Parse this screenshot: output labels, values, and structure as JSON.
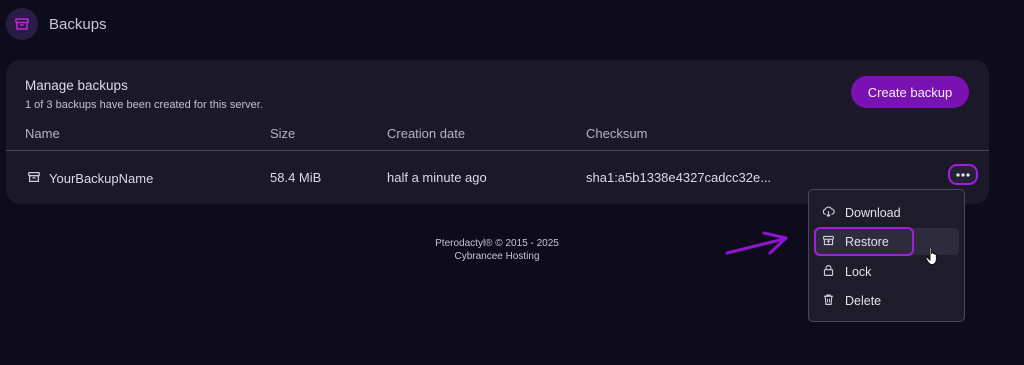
{
  "header": {
    "title": "Backups",
    "icon": "archive-icon"
  },
  "panel": {
    "title": "Manage backups",
    "subtitle": "1 of 3 backups have been created for this server.",
    "create_button": "Create backup"
  },
  "table": {
    "columns": [
      "Name",
      "Size",
      "Creation date",
      "Checksum"
    ],
    "rows": [
      {
        "name": "YourBackupName",
        "size": "58.4 MiB",
        "created": "half a minute ago",
        "checksum": "sha1:a5b1338e4327cadcc32e..."
      }
    ]
  },
  "menu": {
    "items": [
      {
        "label": "Download",
        "icon": "cloud-download-icon"
      },
      {
        "label": "Restore",
        "icon": "archive-restore-icon"
      },
      {
        "label": "Lock",
        "icon": "lock-icon"
      },
      {
        "label": "Delete",
        "icon": "trash-icon"
      }
    ]
  },
  "footer": {
    "line1": "Pterodactyl® © 2015 - 2025",
    "line2": "Cybrancee Hosting"
  },
  "colors": {
    "background": "#0d0b1c",
    "card": "#1a1829",
    "accent": "#7a12b3",
    "highlight": "#a21ee0"
  }
}
